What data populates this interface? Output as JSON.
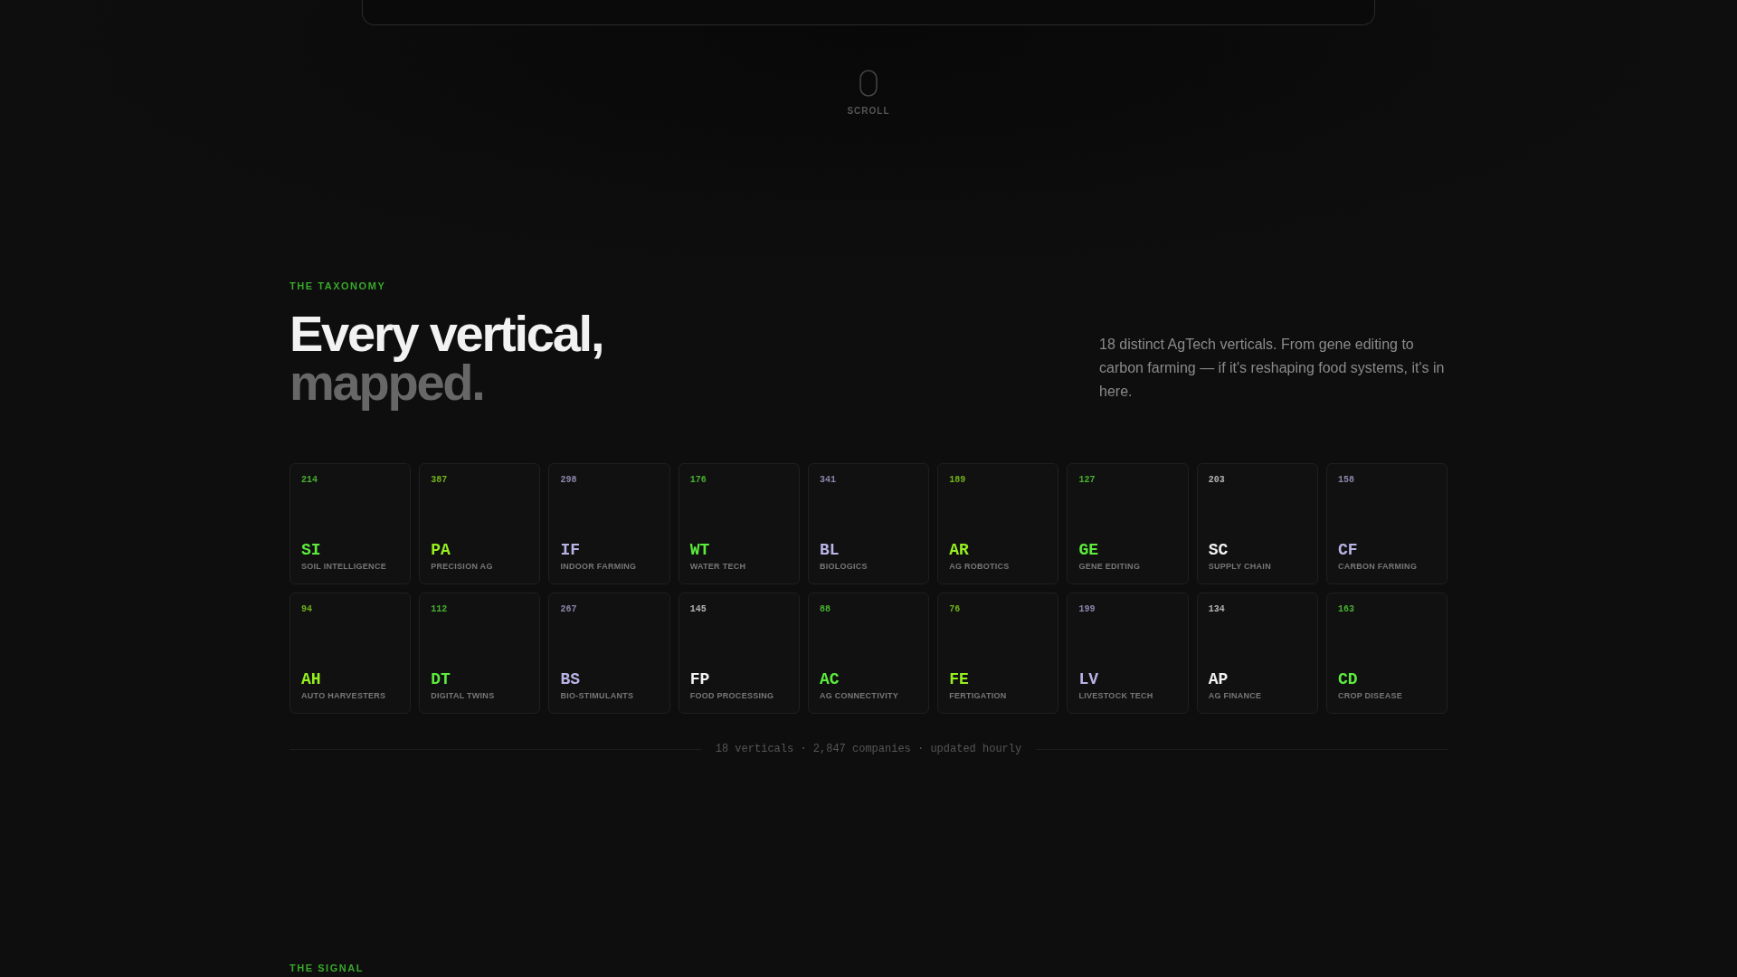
{
  "scroll_hint": {
    "label": "SCROLL"
  },
  "taxonomy": {
    "eyebrow": "THE TAXONOMY",
    "heading": [
      {
        "text": "Every vertical,",
        "muted": false
      },
      {
        "text": "mapped.",
        "muted": true
      }
    ],
    "description": "18 distinct AgTech verticals. From gene editing to carbon farming — if it's reshaping food systems, it's in here.",
    "verticals": [
      {
        "count": "214",
        "code": "SI",
        "label": "SOIL INTELLIGENCE",
        "color": "#5cec3c"
      },
      {
        "count": "387",
        "code": "PA",
        "label": "PRECISION AG",
        "color": "#96ef1e"
      },
      {
        "count": "298",
        "code": "IF",
        "label": "INDOOR FARMING",
        "color": "#b9b3e6"
      },
      {
        "count": "176",
        "code": "WT",
        "label": "WATER TECH",
        "color": "#5cec3c"
      },
      {
        "count": "341",
        "code": "BL",
        "label": "BIOLOGICS",
        "color": "#b9b3e6"
      },
      {
        "count": "189",
        "code": "AR",
        "label": "AG ROBOTICS",
        "color": "#96ef1e"
      },
      {
        "count": "127",
        "code": "GE",
        "label": "GENE EDITING",
        "color": "#5cec3c"
      },
      {
        "count": "203",
        "code": "SC",
        "label": "SUPPLY CHAIN",
        "color": "#f2f2f2"
      },
      {
        "count": "158",
        "code": "CF",
        "label": "CARBON FARMING",
        "color": "#b9b3e6"
      },
      {
        "count": "94",
        "code": "AH",
        "label": "AUTO HARVESTERS",
        "color": "#96ef1e"
      },
      {
        "count": "112",
        "code": "DT",
        "label": "DIGITAL TWINS",
        "color": "#5cec3c"
      },
      {
        "count": "267",
        "code": "BS",
        "label": "BIO-STIMULANTS",
        "color": "#b9b3e6"
      },
      {
        "count": "145",
        "code": "FP",
        "label": "FOOD PROCESSING",
        "color": "#f2f2f2"
      },
      {
        "count": "88",
        "code": "AC",
        "label": "AG CONNECTIVITY",
        "color": "#5cec3c"
      },
      {
        "count": "76",
        "code": "FE",
        "label": "FERTIGATION",
        "color": "#96ef1e"
      },
      {
        "count": "199",
        "code": "LV",
        "label": "LIVESTOCK TECH",
        "color": "#b9b3e6"
      },
      {
        "count": "134",
        "code": "AP",
        "label": "AG FINANCE",
        "color": "#f2f2f2"
      },
      {
        "count": "163",
        "code": "CD",
        "label": "CROP DISEASE",
        "color": "#5cec3c"
      }
    ],
    "footer": "18 verticals · 2,847 companies · updated hourly"
  },
  "signal": {
    "eyebrow": "THE SIGNAL"
  }
}
